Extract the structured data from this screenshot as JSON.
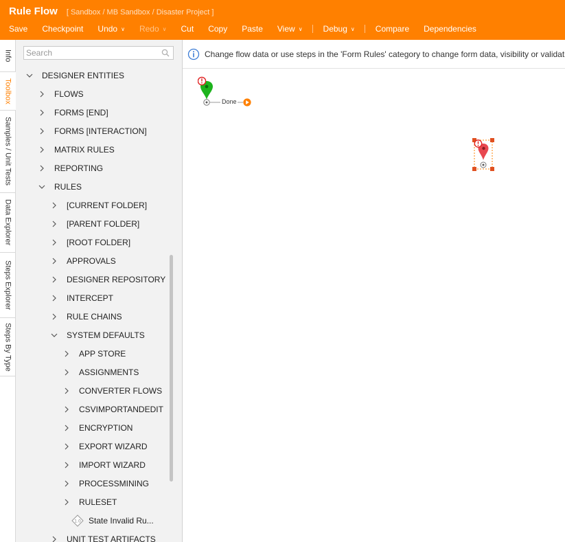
{
  "app": {
    "title": "Rule Flow",
    "breadcrumb": "[ Sandbox / MB Sandbox / Disaster Project ]"
  },
  "menu": [
    {
      "label": "Save",
      "dropdown": false,
      "disabled": false
    },
    {
      "label": "Checkpoint",
      "dropdown": false,
      "disabled": false
    },
    {
      "label": "Undo",
      "dropdown": true,
      "disabled": false
    },
    {
      "label": "Redo",
      "dropdown": true,
      "disabled": true
    },
    {
      "label": "Cut",
      "dropdown": false,
      "disabled": false
    },
    {
      "label": "Copy",
      "dropdown": false,
      "disabled": false
    },
    {
      "label": "Paste",
      "dropdown": false,
      "disabled": false
    },
    {
      "label": "View",
      "dropdown": true,
      "disabled": false
    },
    {
      "separator": true
    },
    {
      "label": "Debug",
      "dropdown": true,
      "disabled": false
    },
    {
      "separator": true
    },
    {
      "label": "Compare",
      "dropdown": false,
      "disabled": false
    },
    {
      "label": "Dependencies",
      "dropdown": false,
      "disabled": false
    }
  ],
  "side_tabs": [
    {
      "label": "Info",
      "active": false
    },
    {
      "label": "Toolbox",
      "active": true
    },
    {
      "label": "Samples / Unit Tests",
      "active": false
    },
    {
      "label": "Data Explorer",
      "active": false
    },
    {
      "label": "Steps Explorer",
      "active": false
    },
    {
      "label": "Steps By Type",
      "active": false
    }
  ],
  "search": {
    "placeholder": "Search",
    "value": ""
  },
  "tree": [
    {
      "label": "DESIGNER ENTITIES",
      "level": 0,
      "expanded": true
    },
    {
      "label": "FLOWS",
      "level": 1,
      "expanded": false
    },
    {
      "label": "FORMS [END]",
      "level": 1,
      "expanded": false
    },
    {
      "label": "FORMS [INTERACTION]",
      "level": 1,
      "expanded": false
    },
    {
      "label": "MATRIX RULES",
      "level": 1,
      "expanded": false
    },
    {
      "label": "REPORTING",
      "level": 1,
      "expanded": false
    },
    {
      "label": "RULES",
      "level": 1,
      "expanded": true
    },
    {
      "label": "[CURRENT FOLDER]",
      "level": 2,
      "expanded": false
    },
    {
      "label": "[PARENT FOLDER]",
      "level": 2,
      "expanded": false
    },
    {
      "label": "[ROOT FOLDER]",
      "level": 2,
      "expanded": false
    },
    {
      "label": "APPROVALS",
      "level": 2,
      "expanded": false
    },
    {
      "label": "DESIGNER REPOSITORY",
      "level": 2,
      "expanded": false
    },
    {
      "label": "INTERCEPT",
      "level": 2,
      "expanded": false
    },
    {
      "label": "RULE CHAINS",
      "level": 2,
      "expanded": false
    },
    {
      "label": "SYSTEM DEFAULTS",
      "level": 2,
      "expanded": true
    },
    {
      "label": "APP STORE",
      "level": 3,
      "expanded": false
    },
    {
      "label": "ASSIGNMENTS",
      "level": 3,
      "expanded": false
    },
    {
      "label": "CONVERTER FLOWS",
      "level": 3,
      "expanded": false
    },
    {
      "label": "CSVIMPORTANDEDIT",
      "level": 3,
      "expanded": false
    },
    {
      "label": "ENCRYPTION",
      "level": 3,
      "expanded": false
    },
    {
      "label": "EXPORT WIZARD",
      "level": 3,
      "expanded": false
    },
    {
      "label": "IMPORT WIZARD",
      "level": 3,
      "expanded": false
    },
    {
      "label": "PROCESSMINING",
      "level": 3,
      "expanded": false
    },
    {
      "label": "RULESET",
      "level": 3,
      "expanded": false
    },
    {
      "label": "State Invalid Ru...",
      "level": 3,
      "leaf": true
    },
    {
      "label": "UNIT TEST ARTIFACTS",
      "level": 2,
      "expanded": false
    }
  ],
  "info_message": "Change flow data or use steps in the 'Form Rules' category to change form data, visibility or validation",
  "canvas": {
    "start_node_label": "Done"
  },
  "colors": {
    "brand": "#ff8000",
    "start_node": "#1db31d",
    "end_node": "#e8474f",
    "error": "#e02020",
    "info": "#3a7bd5"
  }
}
